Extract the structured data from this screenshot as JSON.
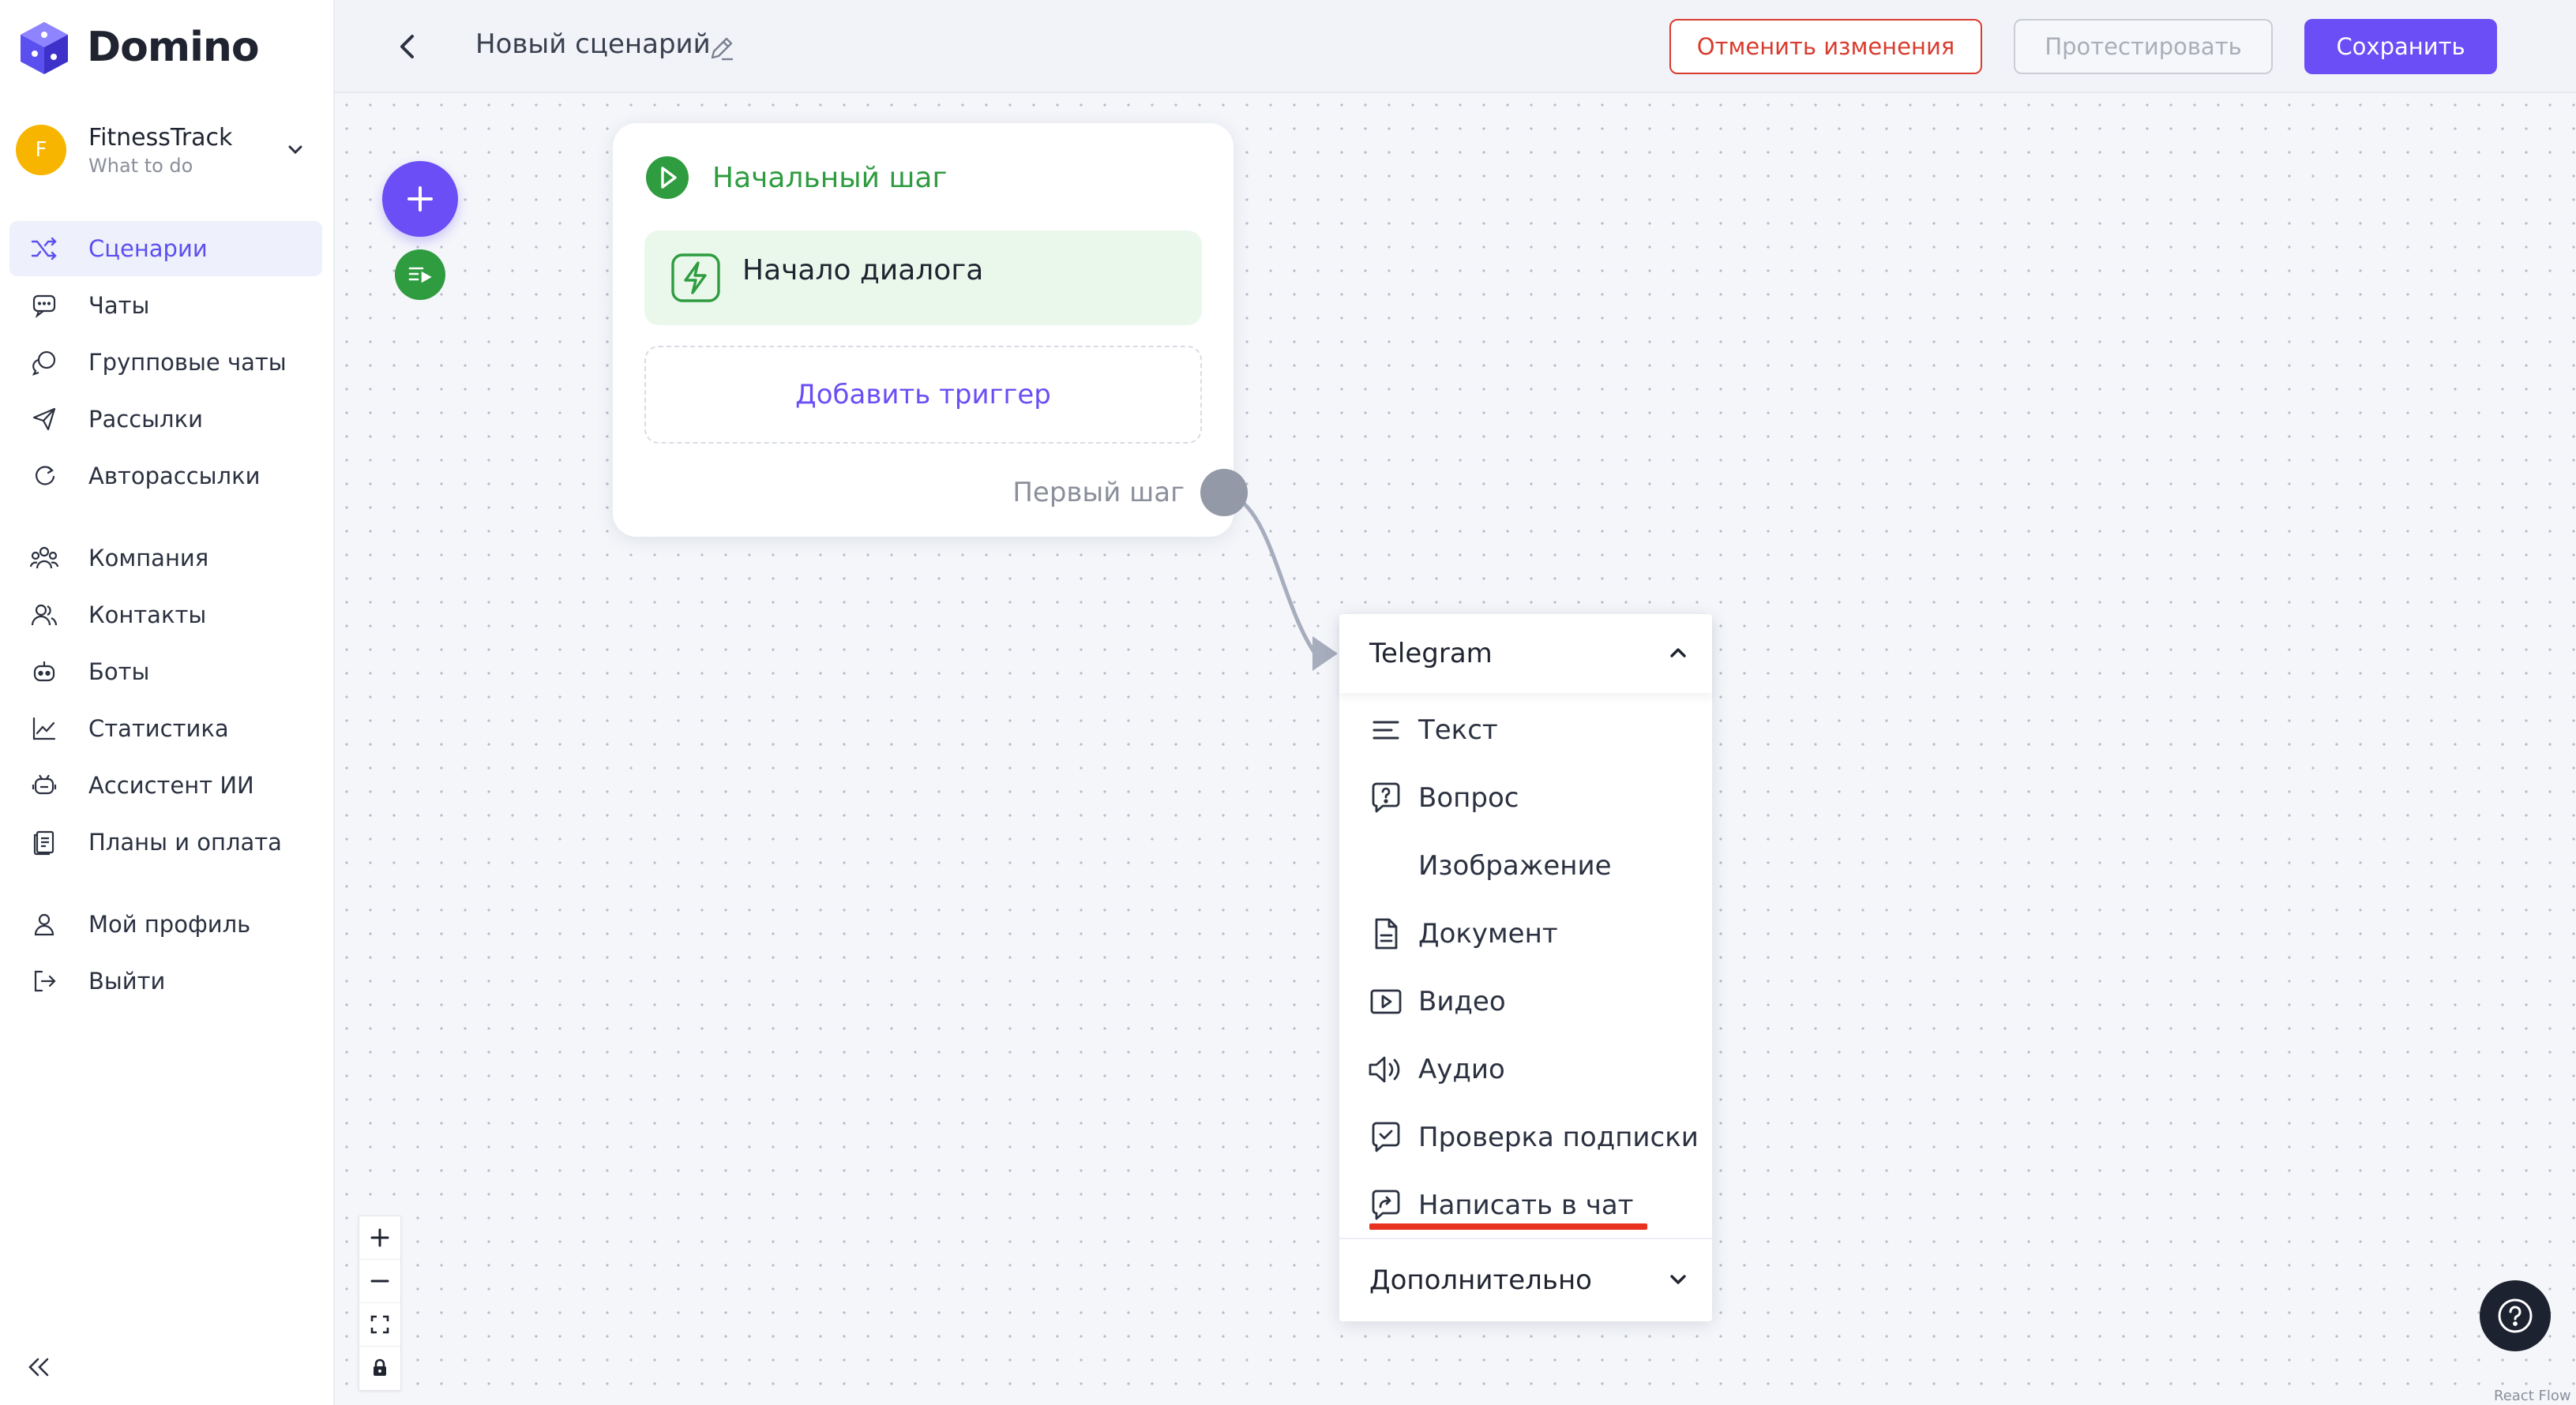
{
  "app": {
    "name": "Domino"
  },
  "org": {
    "initial": "F",
    "name": "FitnessTrack",
    "subtitle": "What to do"
  },
  "sidebar": {
    "items": [
      {
        "label": "Сценарии",
        "icon": "shuffle-icon",
        "active": true
      },
      {
        "label": "Чаты",
        "icon": "chat-bubble-icon",
        "active": false
      },
      {
        "label": "Групповые чаты",
        "icon": "group-chat-icon",
        "active": false
      },
      {
        "label": "Рассылки",
        "icon": "send-icon",
        "active": false
      },
      {
        "label": "Авторассылки",
        "icon": "auto-send-icon",
        "active": false
      },
      {
        "label": "Компания",
        "icon": "company-icon",
        "active": false
      },
      {
        "label": "Контакты",
        "icon": "contacts-icon",
        "active": false
      },
      {
        "label": "Боты",
        "icon": "bot-icon",
        "active": false
      },
      {
        "label": "Статистика",
        "icon": "chart-icon",
        "active": false
      },
      {
        "label": "Ассистент ИИ",
        "icon": "assistant-icon",
        "active": false
      },
      {
        "label": "Планы и оплата",
        "icon": "billing-icon",
        "active": false
      },
      {
        "label": "Мой профиль",
        "icon": "profile-icon",
        "active": false
      },
      {
        "label": "Выйти",
        "icon": "logout-icon",
        "active": false
      }
    ]
  },
  "header": {
    "title": "Новый сценарий",
    "cancel_label": "Отменить изменения",
    "test_label": "Протестировать",
    "save_label": "Сохранить"
  },
  "start_node": {
    "title": "Начальный шаг",
    "trigger_label": "Начало диалога",
    "add_trigger_label": "Добавить триггер",
    "output_label": "Первый шаг"
  },
  "menu": {
    "group_title": "Telegram",
    "items": [
      {
        "label": "Текст",
        "icon": "text-lines-icon"
      },
      {
        "label": "Вопрос",
        "icon": "question-bubble-icon"
      },
      {
        "label": "Изображение",
        "icon": ""
      },
      {
        "label": "Документ",
        "icon": "document-icon"
      },
      {
        "label": "Видео",
        "icon": "video-icon"
      },
      {
        "label": "Аудио",
        "icon": "audio-icon"
      },
      {
        "label": "Проверка подписки",
        "icon": "check-bubble-icon"
      },
      {
        "label": "Написать в чат",
        "icon": "forward-bubble-icon"
      }
    ],
    "more_label": "Дополнительно"
  },
  "footer": {
    "attribution": "React Flow"
  },
  "colors": {
    "accent": "#6b4ef5",
    "success": "#2e9c3f",
    "danger": "#d93c2f",
    "highlight": "#e8321f"
  }
}
